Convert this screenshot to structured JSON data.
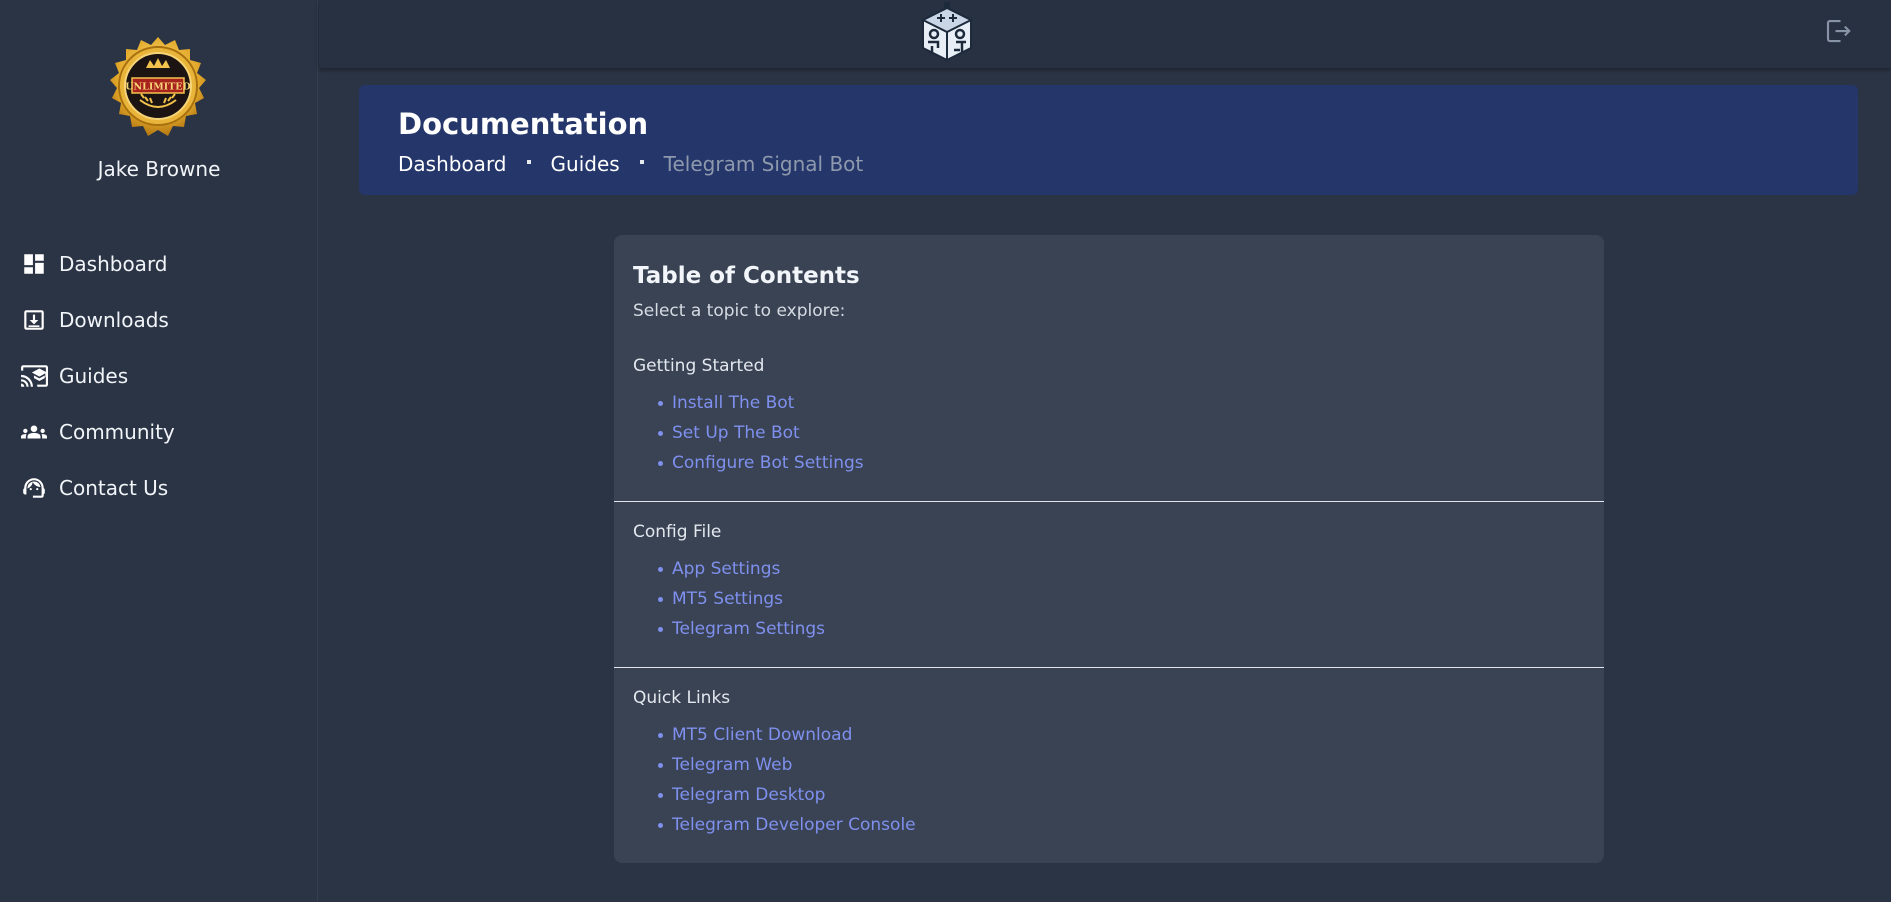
{
  "user": {
    "name": "Jake Browne",
    "badge_text": "UNLIMITED"
  },
  "sidebar": {
    "items": [
      {
        "label": "Dashboard",
        "icon": "dashboard-icon"
      },
      {
        "label": "Downloads",
        "icon": "download-icon"
      },
      {
        "label": "Guides",
        "icon": "guides-icon"
      },
      {
        "label": "Community",
        "icon": "community-icon"
      },
      {
        "label": "Contact Us",
        "icon": "support-agent-icon"
      }
    ]
  },
  "topbar": {
    "logo_icon": "robot-cube-logo",
    "logout_icon": "logout-icon"
  },
  "header": {
    "title": "Documentation",
    "breadcrumb": [
      "Dashboard",
      "Guides",
      "Telegram Signal Bot"
    ]
  },
  "toc": {
    "title": "Table of Contents",
    "subtitle": "Select a topic to explore:",
    "sections": [
      {
        "title": "Getting Started",
        "links": [
          "Install The Bot",
          "Set Up The Bot",
          "Configure Bot Settings"
        ]
      },
      {
        "title": "Config File",
        "links": [
          "App Settings",
          "MT5 Settings",
          "Telegram Settings"
        ]
      },
      {
        "title": "Quick Links",
        "links": [
          "MT5 Client Download",
          "Telegram Web",
          "Telegram Desktop",
          "Telegram Developer Console"
        ]
      }
    ]
  },
  "colors": {
    "background": "#2b3444",
    "header_card": "#24366a",
    "toc_card": "#394354",
    "link": "#7f90ee",
    "badge_gold": "#e8b43a"
  }
}
